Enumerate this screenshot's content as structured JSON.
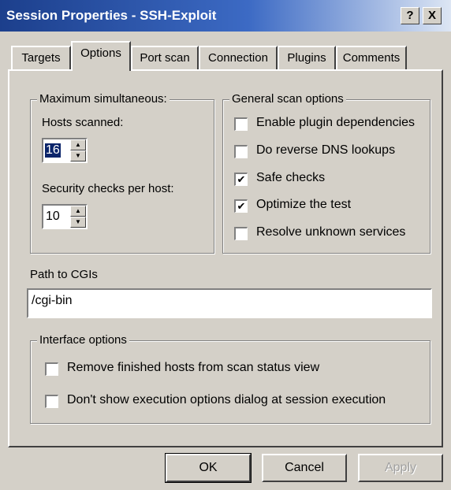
{
  "window": {
    "title": "Session Properties - SSH-Exploit",
    "help_button": "?",
    "close_button": "X"
  },
  "tabs": [
    {
      "label": "Targets",
      "active": false
    },
    {
      "label": "Options",
      "active": true
    },
    {
      "label": "Port scan",
      "active": false
    },
    {
      "label": "Connection",
      "active": false
    },
    {
      "label": "Plugins",
      "active": false
    },
    {
      "label": "Comments",
      "active": false
    }
  ],
  "max_simultaneous": {
    "group_label": "Maximum simultaneous:",
    "hosts_label": "Hosts scanned:",
    "hosts_value": "16",
    "checks_label": "Security checks per host:",
    "checks_value": "10"
  },
  "general_scan": {
    "group_label": "General scan options",
    "options": [
      {
        "label": "Enable plugin dependencies",
        "checked": false
      },
      {
        "label": "Do reverse DNS lookups",
        "checked": false
      },
      {
        "label": "Safe checks",
        "checked": true
      },
      {
        "label": "Optimize the test",
        "checked": true
      },
      {
        "label": "Resolve unknown services",
        "checked": false
      }
    ]
  },
  "cgi": {
    "label": "Path to CGIs",
    "value": "/cgi-bin"
  },
  "interface": {
    "group_label": "Interface options",
    "options": [
      {
        "label": "Remove finished hosts from scan status view",
        "checked": false
      },
      {
        "label": "Don't show execution options dialog at session execution",
        "checked": false
      }
    ]
  },
  "buttons": {
    "ok": "OK",
    "cancel": "Cancel",
    "apply": "Apply"
  },
  "glyphs": {
    "check": "✔",
    "spin_up": "▲",
    "spin_down": "▼"
  },
  "colors": {
    "face": "#d4d0c8",
    "title_start": "#1c3f8c",
    "selection": "#0a246a"
  }
}
